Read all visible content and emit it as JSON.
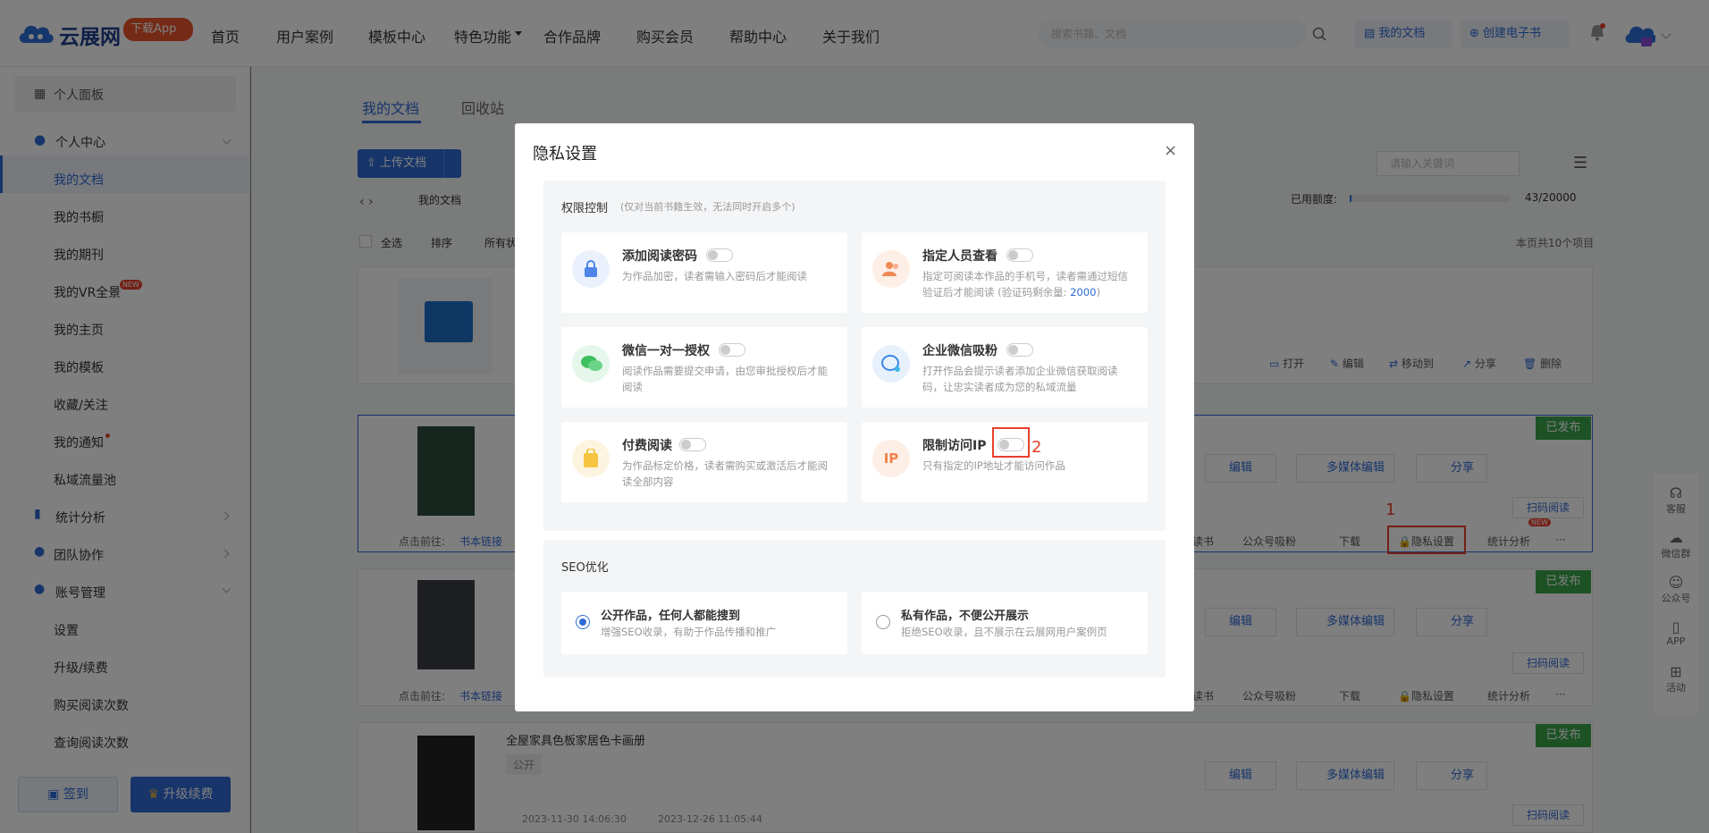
{
  "header": {
    "logo_text": "云展网",
    "app_badge": "下载App",
    "nav": [
      "首页",
      "用户案例",
      "模板中心",
      "特色功能",
      "合作品牌",
      "购买会员",
      "帮助中心",
      "关于我们"
    ],
    "search_placeholder": "搜索书籍、文档",
    "my_docs": "我的文档",
    "create_book": "创建电子书"
  },
  "sidebar": {
    "panel": "个人面板",
    "personal_center": "个人中心",
    "items": [
      "我的文档",
      "我的书橱",
      "我的期刊",
      "我的VR全景",
      "我的主页",
      "我的模板",
      "收藏/关注",
      "我的通知",
      "私域流量池"
    ],
    "new_badge": "NEW",
    "stats": "统计分析",
    "team": "团队协作",
    "account": "账号管理",
    "account_items": [
      "设置",
      "升级/续费",
      "购买阅读次数",
      "查询阅读次数"
    ],
    "checkin": "签到",
    "upgrade": "升级续费"
  },
  "main": {
    "tabs": [
      "我的文档",
      "回收站"
    ],
    "upload": "上传文档",
    "breadcrumb": "我的文档",
    "search_placeholder": "请输入关键词",
    "quota_label": "已用额度:",
    "quota_value": "43/20000",
    "quota_fraction": 0.002,
    "select_all": "全选",
    "sort": "排序",
    "filter": "所有状",
    "total": "本页共10个项目",
    "folder_actions": [
      "打开",
      "编辑",
      "移动到",
      "分享",
      "删除"
    ],
    "published": "已发布",
    "book_actions": [
      "编辑",
      "多媒体编辑",
      "分享"
    ],
    "scan_read": "扫码阅读",
    "goto_label": "点击前往:",
    "book_link": "书本链接",
    "bottom_actions": [
      "读书",
      "公众号吸粉",
      "下载",
      "隐私设置",
      "统计分析"
    ],
    "more": "···",
    "book3_title": "全屋家具色板家居色卡画册",
    "book3_tag": "公开",
    "book3_created": "2023-11-30 14:06:30",
    "book3_modified": "2023-12-26 11:05:44"
  },
  "right_rail": [
    "客服",
    "微信群",
    "公众号",
    "APP",
    "活动"
  ],
  "modal": {
    "title": "隐私设置",
    "close": "×",
    "perm_title": "权限控制",
    "perm_note": "(仅对当前书籍生效，无法同时开启多个)",
    "options": [
      {
        "title": "添加阅读密码",
        "desc": "为作品加密，读者需输入密码后才能阅读"
      },
      {
        "title": "指定人员查看",
        "desc": "指定可阅读本作品的手机号，读者需通过短信验证后才能阅读 (验证码剩余量: ",
        "highlight": "2000",
        "desc_tail": ")"
      },
      {
        "title": "微信一对一授权",
        "desc": "阅读作品需要提交申请，由您审批授权后才能阅读"
      },
      {
        "title": "企业微信吸粉",
        "desc": "打开作品会提示读者添加企业微信获取阅读码，让忠实读者成为您的私域流量"
      },
      {
        "title": "付费阅读",
        "desc": "为作品标定价格，读者需购买或激活后才能阅读全部内容"
      },
      {
        "title": "限制访问IP",
        "desc": "只有指定的IP地址才能访问作品"
      }
    ],
    "ip_icon_text": "IP",
    "seo_title": "SEO优化",
    "seo_options": [
      {
        "title": "公开作品，任何人都能搜到",
        "desc": "增强SEO收录，有助于作品传播和推广"
      },
      {
        "title": "私有作品，不便公开展示",
        "desc": "拒绝SEO收录，且不展示在云展网用户案例页"
      }
    ]
  },
  "annotations": {
    "one": "1",
    "two": "2"
  },
  "colors": {
    "brand": "#2f6ad5",
    "published": "#3aa54b",
    "annotation": "#e8402c"
  }
}
